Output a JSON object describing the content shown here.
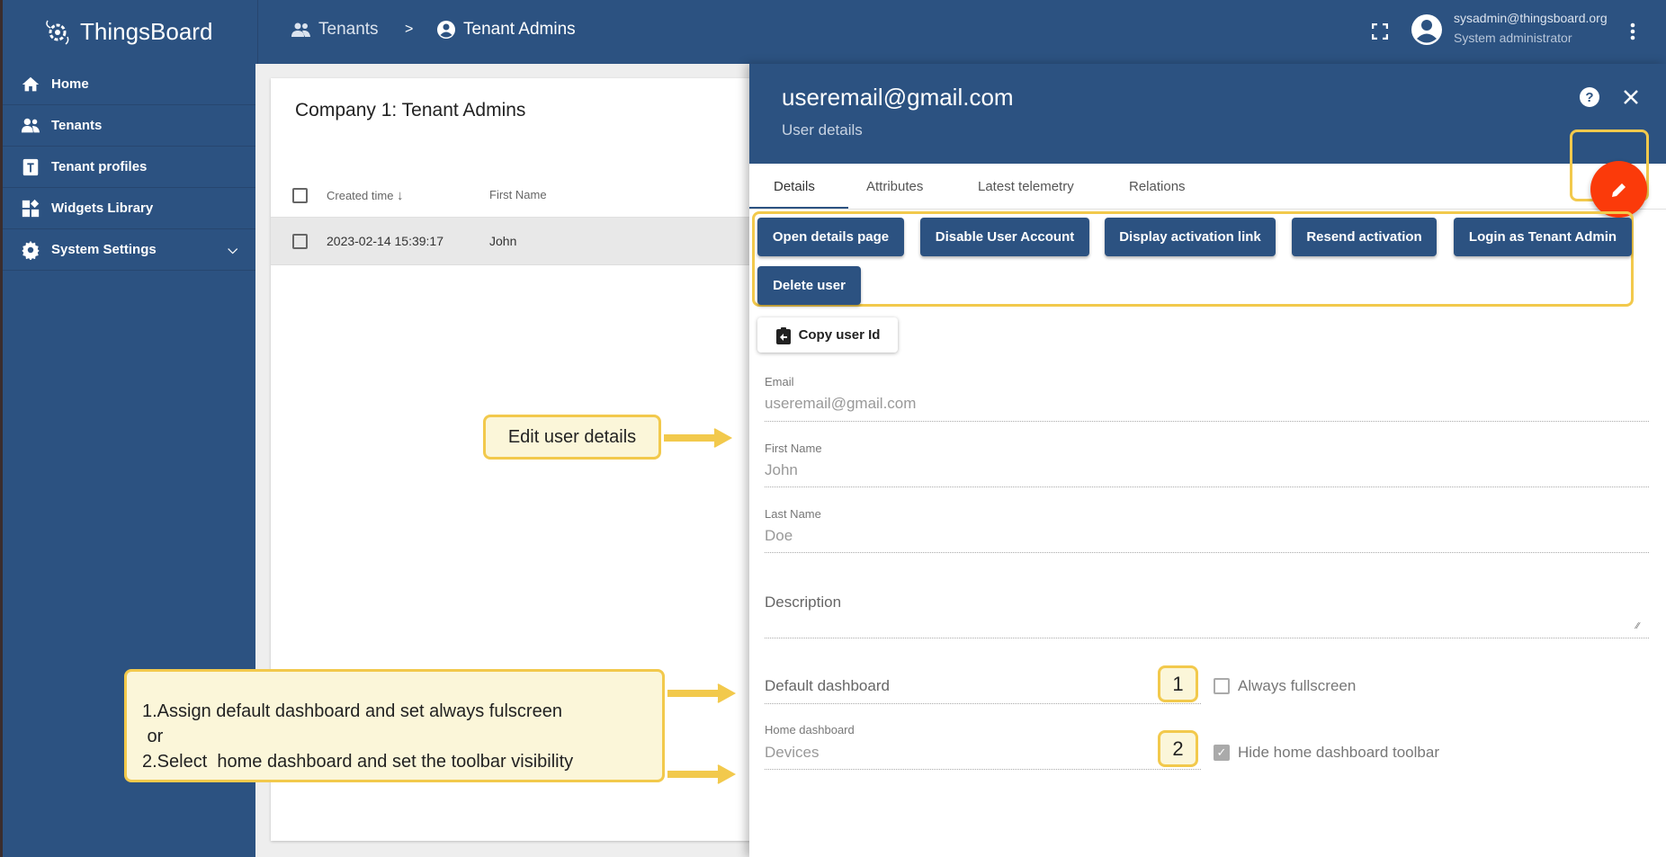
{
  "app": {
    "name": "ThingsBoard"
  },
  "breadcrumb": [
    {
      "label": "Tenants",
      "icon": "people-icon"
    },
    {
      "separator": ">"
    },
    {
      "label": "Tenant Admins",
      "icon": "account-circle-icon"
    }
  ],
  "user": {
    "email": "sysadmin@thingsboard.org",
    "role": "System administrator"
  },
  "sidebar": {
    "items": [
      {
        "label": "Home",
        "icon": "home-icon"
      },
      {
        "label": "Tenants",
        "icon": "people-icon"
      },
      {
        "label": "Tenant profiles",
        "icon": "tenant-profile-icon"
      },
      {
        "label": "Widgets Library",
        "icon": "widgets-icon"
      },
      {
        "label": "System Settings",
        "icon": "gear-icon",
        "expandable": true
      }
    ]
  },
  "card": {
    "title": "Company 1: Tenant Admins",
    "columns": [
      "Created time",
      "First Name"
    ],
    "rows": [
      {
        "created": "2023-02-14 15:39:17",
        "first_name": "John"
      }
    ]
  },
  "drawer": {
    "title": "useremail@gmail.com",
    "subtitle": "User details",
    "tabs": [
      "Details",
      "Attributes",
      "Latest telemetry",
      "Relations"
    ],
    "active_tab": "Details",
    "buttons": [
      "Open details page",
      "Disable User Account",
      "Display activation link",
      "Resend activation",
      "Login as Tenant Admin",
      "Delete user"
    ],
    "copy_button": "Copy user Id",
    "fields": {
      "email": {
        "label": "Email",
        "value": "useremail@gmail.com"
      },
      "first_name": {
        "label": "First Name",
        "value": "John"
      },
      "last_name": {
        "label": "Last Name",
        "value": "Doe"
      },
      "description": {
        "label": "Description"
      },
      "default_dashboard": {
        "label": "Default dashboard"
      },
      "home_dashboard": {
        "label": "Home dashboard",
        "value": "Devices"
      }
    },
    "always_fullscreen": {
      "label": "Always fullscreen",
      "checked": false
    },
    "hide_toolbar": {
      "label": "Hide home dashboard toolbar",
      "checked": true
    }
  },
  "annotations": {
    "edit": "Edit user details",
    "marker1": "1",
    "marker2": "2",
    "line1": "1.Assign default dashboard and set always fulscreen",
    "line2": " or",
    "line3": "2.Select  home dashboard and set the toolbar visibility"
  },
  "colors": {
    "primary": "#2c5281",
    "fab": "#fb3a0a",
    "callout_bg": "#fbf6d9",
    "callout_border": "#f2c94c"
  }
}
